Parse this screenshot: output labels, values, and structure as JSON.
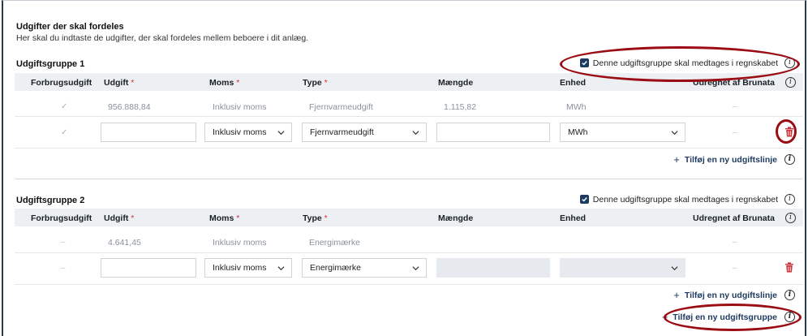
{
  "section": {
    "title": "Udgifter der skal fordeles",
    "intro": "Her skal du indtaste de udgifter, der skal fordeles mellem beboere i dit anlæg."
  },
  "columns": {
    "forbrugsudgift": "Forbrugsudgift",
    "udgift": "Udgift",
    "moms": "Moms",
    "type": "Type",
    "maengde": "Mængde",
    "enhed": "Enhed",
    "udregnet": "Udregnet af Brunata",
    "required_mark": "*"
  },
  "groups": [
    {
      "title": "Udgiftsgruppe 1",
      "include_label": "Denne udgiftsgruppe skal medtages i regnskabet",
      "include_checked": true,
      "row": {
        "forbrugsudgift": "✓",
        "udgift": "956.888,84",
        "moms": "Inklusiv moms",
        "type": "Fjernvarmeudgift",
        "maengde": "1.115,82",
        "enhed": "MWh",
        "udregnet": "–"
      },
      "edit": {
        "forbrugsudgift": "✓",
        "udgift_value": "",
        "moms_value": "Inklusiv moms",
        "type_value": "Fjernvarmeudgift",
        "maengde_value": "",
        "enhed_value": "MWh",
        "udregnet": "–"
      },
      "add_line_label": "Tilføj en ny udgiftslinje"
    },
    {
      "title": "Udgiftsgruppe 2",
      "include_label": "Denne udgiftsgruppe skal medtages i regnskabet",
      "include_checked": true,
      "row": {
        "forbrugsudgift": "–",
        "udgift": "4.641,45",
        "moms": "Inklusiv moms",
        "type": "Energimærke",
        "maengde": "",
        "enhed": "",
        "udregnet": "–"
      },
      "edit": {
        "forbrugsudgift": "–",
        "udgift_value": "",
        "moms_value": "Inklusiv moms",
        "type_value": "Energimærke",
        "maengde_value": "",
        "enhed_value": "",
        "udregnet": "–"
      },
      "add_line_label": "Tilføj en ny udgiftslinje"
    }
  ],
  "add_group_label": "Tilføj en ny udgiftsgruppe",
  "plus_symbol": "+",
  "info_symbol": "i",
  "icons": {
    "checkbox": "checkbox-checked-icon",
    "info": "info-icon",
    "chevron": "chevron-down-icon",
    "trash": "trash-icon",
    "plus": "plus-icon"
  },
  "colors": {
    "brand": "#1e3a5f",
    "danger": "#d0343a",
    "annotation": "#9b0d14"
  }
}
